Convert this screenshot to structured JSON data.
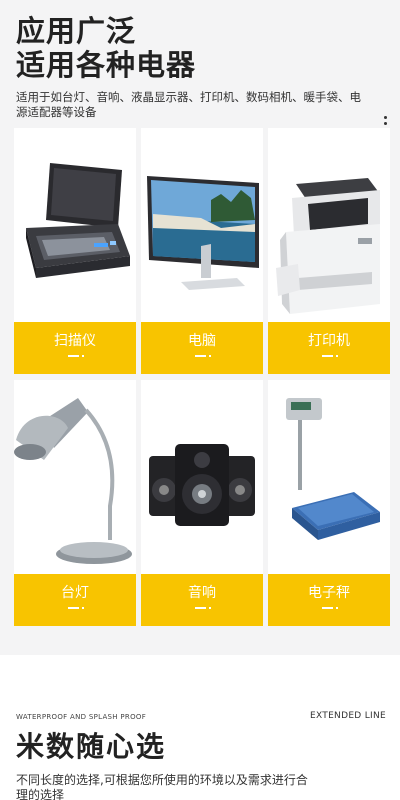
{
  "header": {
    "title_line1": "应用广泛",
    "title_line2": "适用各种电器",
    "subtitle": "适用于如台灯、音响、液晶显示器、打印机、数码相机、暖手袋、电源适配器等设备"
  },
  "products": [
    {
      "label": "扫描仪",
      "icon": "scanner-icon"
    },
    {
      "label": "电脑",
      "icon": "monitor-icon"
    },
    {
      "label": "打印机",
      "icon": "printer-icon"
    },
    {
      "label": "台灯",
      "icon": "desk-lamp-icon"
    },
    {
      "label": "音响",
      "icon": "speaker-icon"
    },
    {
      "label": "电子秤",
      "icon": "electronic-scale-icon"
    }
  ],
  "bottom": {
    "waterproof_tag": "WATERPROOF AND SPLASH PROOF",
    "extended_tag": "EXTENDED LINE",
    "title": "米数随心选",
    "desc": "不同长度的选择,可根据您所使用的环境以及需求进行合理的选择"
  },
  "colors": {
    "accent": "#f8c400",
    "background_top": "#f4f4f5",
    "card": "#ffffff",
    "text": "#222222"
  }
}
